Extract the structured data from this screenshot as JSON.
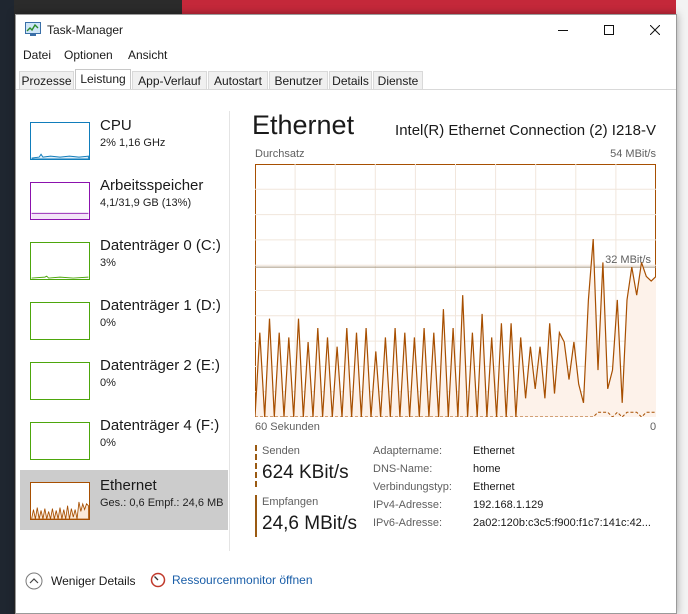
{
  "window": {
    "title": "Task-Manager"
  },
  "menu": [
    "Datei",
    "Optionen",
    "Ansicht"
  ],
  "tabs": [
    "Prozesse",
    "Leistung",
    "App-Verlauf",
    "Autostart",
    "Benutzer",
    "Details",
    "Dienste"
  ],
  "active_tab": "Leistung",
  "sidebar": {
    "items": [
      {
        "name": "CPU",
        "sub": "2%  1,16 GHz",
        "color": "#117dbb"
      },
      {
        "name": "Arbeitsspeicher",
        "sub": "4,1/31,9 GB (13%)",
        "color": "#8b12ae"
      },
      {
        "name": "Datenträger 0 (C:)",
        "sub": "3%",
        "color": "#4da60c"
      },
      {
        "name": "Datenträger 1 (D:)",
        "sub": "0%",
        "color": "#4da60c"
      },
      {
        "name": "Datenträger 2 (E:)",
        "sub": "0%",
        "color": "#4da60c"
      },
      {
        "name": "Datenträger 4 (F:)",
        "sub": "0%",
        "color": "#4da60c"
      },
      {
        "name": "Ethernet",
        "sub": "Ges.: 0,6  Empf.: 24,6 MB",
        "color": "#a74f01"
      }
    ]
  },
  "main": {
    "title": "Ethernet",
    "adapter": "Intel(R) Ethernet Connection (2) I218-V",
    "throughput_label": "Durchsatz",
    "max_label": "54 MBit/s",
    "mid_label": "32 MBit/s",
    "time_left": "60 Sekunden",
    "time_right": "0",
    "send_label": "Senden",
    "send_value": "624 KBit/s",
    "recv_label": "Empfangen",
    "recv_value": "24,6 MBit/s",
    "details": [
      {
        "label": "Adaptername:",
        "value": "Ethernet"
      },
      {
        "label": "DNS-Name:",
        "value": "home"
      },
      {
        "label": "Verbindungstyp:",
        "value": "Ethernet"
      },
      {
        "label": "IPv4-Adresse:",
        "value": "192.168.1.129"
      },
      {
        "label": "IPv6-Adresse:",
        "value": "2a02:120b:c3c5:f900:f1c7:141c:42..."
      }
    ]
  },
  "chart_data": {
    "type": "line",
    "ylim": [
      0,
      54
    ],
    "xlim": [
      60,
      0
    ],
    "series": [
      {
        "values": [
          0,
          18,
          0,
          21,
          0,
          18,
          0,
          17,
          0,
          21,
          0,
          16,
          0,
          19,
          0,
          17,
          0,
          15,
          0,
          19,
          0,
          18,
          0,
          19,
          0,
          14,
          0,
          17,
          0,
          19,
          0,
          18,
          0,
          17,
          0,
          19,
          0,
          18,
          0,
          23,
          0,
          19,
          0,
          26,
          0,
          18,
          0,
          22,
          0,
          17,
          0,
          20,
          0,
          20,
          0,
          17,
          4,
          15,
          6,
          15,
          4,
          20,
          5,
          18,
          16,
          8,
          16,
          7,
          3,
          25,
          38,
          10,
          33,
          6,
          10,
          25,
          3,
          25,
          32,
          26,
          33,
          30,
          29,
          30
        ]
      },
      {
        "values": [
          0,
          0,
          0,
          0,
          0,
          0,
          0,
          0,
          0,
          0,
          0,
          0,
          0,
          0,
          0,
          0,
          0,
          0,
          0,
          0,
          0,
          0,
          0,
          0,
          0,
          0,
          0,
          0,
          0,
          0,
          0,
          0,
          0,
          0,
          0,
          0,
          0,
          0,
          0,
          0,
          0,
          0,
          0,
          0,
          0,
          0,
          0,
          0,
          0,
          0,
          0,
          0,
          0,
          0,
          0,
          0,
          0,
          0,
          0,
          0,
          0,
          0,
          0,
          0,
          0,
          0,
          0,
          0,
          0,
          0,
          0,
          1,
          1,
          1,
          0,
          1,
          0,
          1,
          1,
          1,
          0,
          1,
          1,
          1
        ]
      }
    ],
    "accent": "#a74f01",
    "fill": "#fdf2ea"
  },
  "footer": {
    "less_details": "Weniger Details",
    "resource_monitor": "Ressourcenmonitor öffnen"
  }
}
